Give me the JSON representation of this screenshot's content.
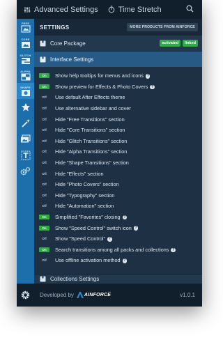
{
  "topbar": {
    "tab1": "Advanced Settings",
    "tab2": "Time Stretch"
  },
  "sidebar": {
    "items": [
      {
        "caption": "FREE",
        "icon": "free-icon"
      },
      {
        "caption": "CORE",
        "icon": "core-icon"
      },
      {
        "caption": "GLITCH",
        "icon": "glitch-icon"
      },
      {
        "caption": "ALPHA",
        "icon": "alpha-icon"
      },
      {
        "caption": "SHAPE",
        "icon": "shape-icon"
      },
      {
        "caption": "",
        "icon": "star-icon"
      },
      {
        "caption": "",
        "icon": "magic-wand-icon"
      },
      {
        "caption": "",
        "icon": "photo-icon"
      },
      {
        "caption": "",
        "icon": "typography-icon"
      },
      {
        "caption": "",
        "icon": "automation-gear-icon"
      }
    ]
  },
  "settings": {
    "title": "SETTINGS",
    "more_label": "MORE PRODUCTS FROM AINFORCE"
  },
  "core_package": {
    "label": "Core Package",
    "badge_activated": "activated",
    "badge_linked": "linked"
  },
  "interface_section": {
    "label": "Interface Settings",
    "options": [
      {
        "state": "on",
        "label": "Show help tooltips for menus and icons",
        "help": true
      },
      {
        "state": "on",
        "label": "Show preview for Effects & Photo Covers",
        "help": true
      },
      {
        "state": "off",
        "label": "Use default After Effects theme",
        "help": false
      },
      {
        "state": "off",
        "label": "Use alternative sidebar and cover",
        "help": false
      },
      {
        "state": "off",
        "label": "Hide \"Free Transitions\" section",
        "help": false
      },
      {
        "state": "off",
        "label": "Hide \"Core Transitions\" section",
        "help": false
      },
      {
        "state": "off",
        "label": "Hide \"Glitch Transitions\" section",
        "help": false
      },
      {
        "state": "off",
        "label": "Hide \"Alpha Transitions\" section",
        "help": false
      },
      {
        "state": "off",
        "label": "Hide \"Shape Transitions\" section",
        "help": false
      },
      {
        "state": "off",
        "label": "Hide \"Effects\" section",
        "help": false
      },
      {
        "state": "off",
        "label": "Hide \"Photo Covers\" section",
        "help": false
      },
      {
        "state": "off",
        "label": "Hide \"Typography\" section",
        "help": false
      },
      {
        "state": "off",
        "label": "Hide \"Automation\" section",
        "help": false
      },
      {
        "state": "on",
        "label": "Simplified \"Favorites\" closing",
        "help": true
      },
      {
        "state": "on",
        "label": "Show \"Speed Control\" switch icon",
        "help": true
      },
      {
        "state": "off",
        "label": "Show \"Speed Control\"",
        "help": true
      },
      {
        "state": "on",
        "label": "Search transitions among all packs and collections",
        "help": true
      },
      {
        "state": "off",
        "label": "Use offline activation method",
        "help": true
      }
    ]
  },
  "collections_section": {
    "label": "Collections Settings"
  },
  "footer": {
    "developed_by": "Developed by",
    "brand": "AINFORCE",
    "version": "v1.0.1"
  },
  "toggle_labels": {
    "on": "On",
    "off": "Off"
  },
  "colors": {
    "accent": "#1d6fab",
    "on_green": "#2eaa46",
    "section_blue": "#275b86",
    "panel_bg": "#1e3144"
  }
}
